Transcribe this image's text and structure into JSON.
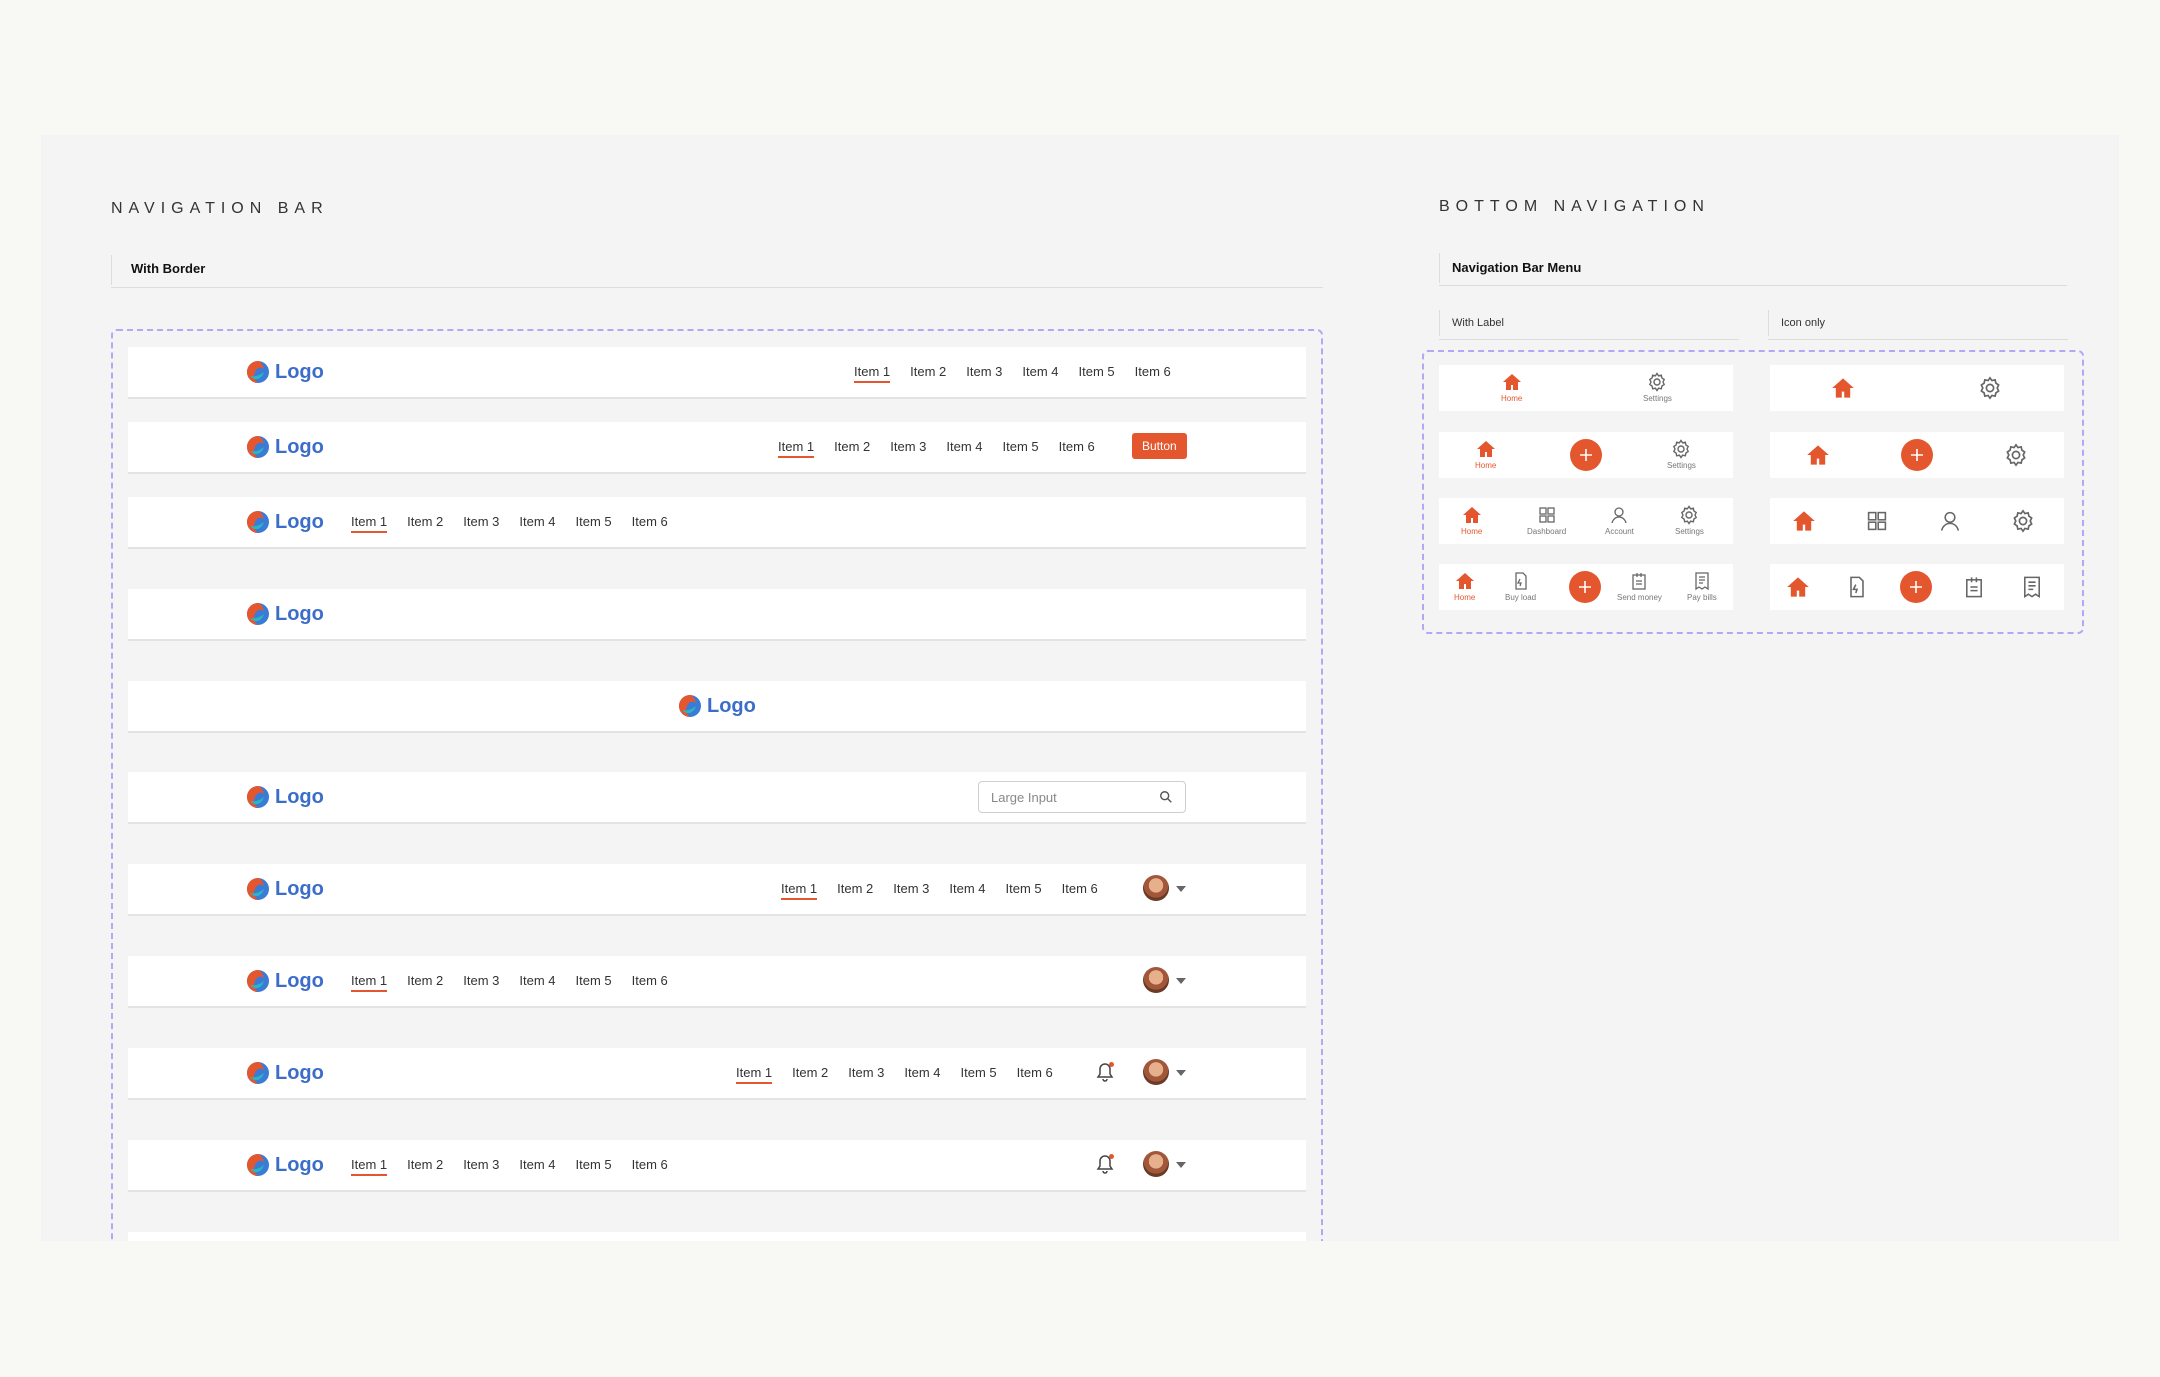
{
  "sections": {
    "navigation_bar": "NAVIGATION BAR",
    "bottom_navigation": "BOTTOM NAVIGATION"
  },
  "subtitles": {
    "with_border": "With Border",
    "nav_bar_menu": "Navigation Bar Menu",
    "with_label": "With Label",
    "icon_only": "Icon only"
  },
  "logo": "Logo",
  "items": [
    "Item 1",
    "Item 2",
    "Item 3",
    "Item 4",
    "Item 5",
    "Item 6"
  ],
  "button_label": "Button",
  "input_placeholder": "Large Input",
  "bottom_labels": {
    "home": "Home",
    "settings": "Settings",
    "dashboard": "Dashboard",
    "account": "Account",
    "buy_load": "Buy load",
    "send_money": "Send money",
    "pay_bills": "Pay bills"
  },
  "colors": {
    "accent": "#e4572e",
    "logo_text": "#3c6ec9",
    "dashed_frame": "#b4a7f5"
  },
  "icons": [
    "home-icon",
    "gear-icon",
    "plus-icon",
    "grid-icon",
    "user-icon",
    "phone-load-icon",
    "money-transfer-icon",
    "receipt-icon",
    "bell-icon",
    "search-icon",
    "avatar",
    "caret-down-icon"
  ]
}
